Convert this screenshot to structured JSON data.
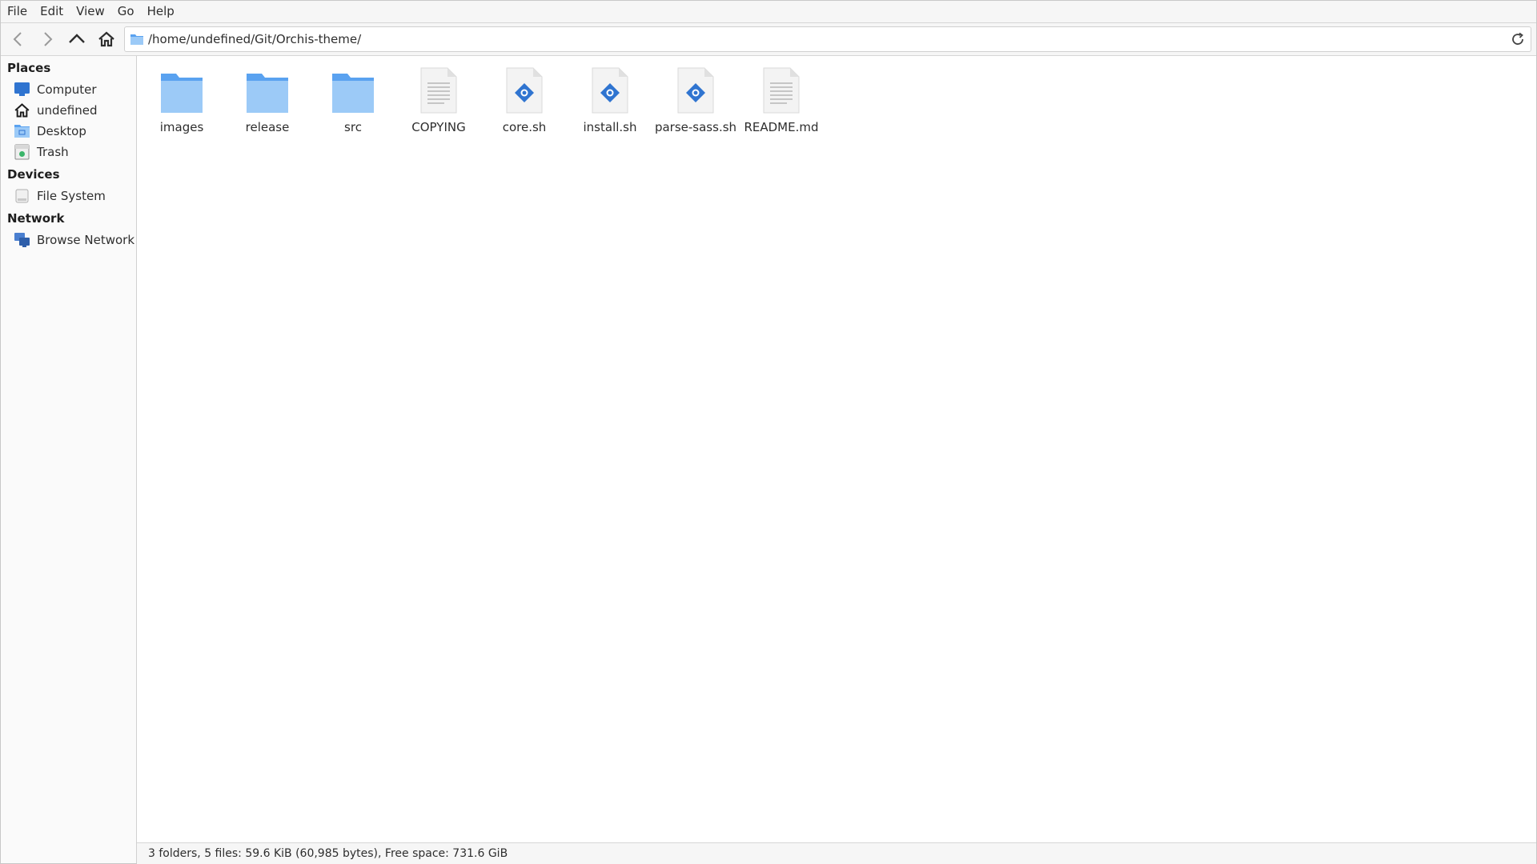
{
  "menu": [
    "File",
    "Edit",
    "View",
    "Go",
    "Help"
  ],
  "toolbar": {
    "back_icon": "back-arrow-icon",
    "forward_icon": "forward-arrow-icon",
    "up_icon": "up-arrow-icon",
    "home_icon": "home-icon",
    "address": "/home/undefined/Git/Orchis-theme/",
    "reload_icon": "reload-icon"
  },
  "sidebar": {
    "places_label": "Places",
    "places": [
      {
        "label": "Computer",
        "icon": "computer-icon"
      },
      {
        "label": "undefined",
        "icon": "home-icon"
      },
      {
        "label": "Desktop",
        "icon": "desktop-folder-icon"
      },
      {
        "label": "Trash",
        "icon": "trash-icon"
      }
    ],
    "devices_label": "Devices",
    "devices": [
      {
        "label": "File System",
        "icon": "drive-icon"
      }
    ],
    "network_label": "Network",
    "network": [
      {
        "label": "Browse Network",
        "icon": "network-icon"
      }
    ]
  },
  "files": [
    {
      "name": "images",
      "type": "folder"
    },
    {
      "name": "release",
      "type": "folder"
    },
    {
      "name": "src",
      "type": "folder"
    },
    {
      "name": "COPYING",
      "type": "text"
    },
    {
      "name": "core.sh",
      "type": "script"
    },
    {
      "name": "install.sh",
      "type": "script"
    },
    {
      "name": "parse-sass.sh",
      "type": "script"
    },
    {
      "name": "README.md",
      "type": "text"
    }
  ],
  "status": "3 folders, 5 files: 59.6 KiB (60,985 bytes), Free space: 731.6 GiB",
  "colors": {
    "folder": "#5aa2f0",
    "folder_light": "#9ccaf7",
    "accent": "#2f74d0",
    "text": "#2e2e2e"
  }
}
